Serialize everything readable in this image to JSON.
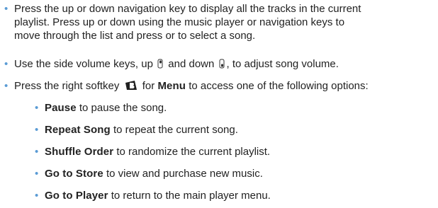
{
  "items": [
    {
      "lines": [
        "Press the up or down navigation key to display all the tracks in the current",
        "playlist. Press up or down using the music player or navigation keys to",
        "move through the list and press or to select a song."
      ]
    },
    {
      "before": "Use the side volume keys, up",
      "middle": "and down",
      "after": ", to adjust song volume.",
      "icons": [
        "volume-up-key-icon",
        "volume-down-key-icon"
      ]
    },
    {
      "before": "Press the right softkey",
      "middle": "for",
      "bold": "Menu",
      "after": "to access one of the following options:",
      "icons": [
        "right-softkey-icon"
      ]
    }
  ],
  "options": [
    {
      "bold": "Pause",
      "text": "to pause the song."
    },
    {
      "bold": "Repeat Song",
      "text": "to repeat the current song."
    },
    {
      "bold": "Shuffle Order",
      "text": "to randomize the current playlist."
    },
    {
      "bold": "Go to Store",
      "text": "to view and purchase new music."
    },
    {
      "bold": "Go to Player",
      "text": "to return to the main player menu."
    }
  ],
  "colors": {
    "bullet": "#5a9bd5",
    "text": "#222222"
  }
}
